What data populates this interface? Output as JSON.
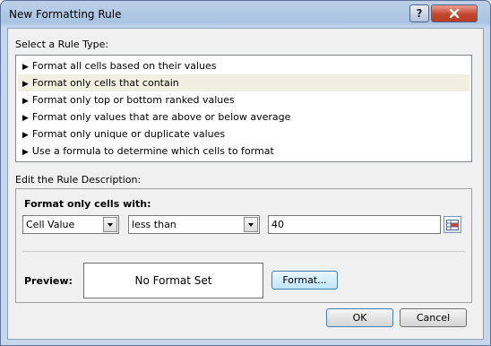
{
  "dialog": {
    "title": "New Formatting Rule",
    "help_label": "?",
    "close_label": "X"
  },
  "rule_type": {
    "label": "Select a Rule Type:",
    "items": [
      {
        "label": "Format all cells based on their values"
      },
      {
        "label": "Format only cells that contain"
      },
      {
        "label": "Format only top or bottom ranked values"
      },
      {
        "label": "Format only values that are above or below average"
      },
      {
        "label": "Format only unique or duplicate values"
      },
      {
        "label": "Use a formula to determine which cells to format"
      }
    ],
    "selected_index": 1
  },
  "description": {
    "label": "Edit the Rule Description:",
    "panel_title": "Format only cells with:",
    "condition_type": "Cell Value",
    "operator": "less than",
    "value": "40"
  },
  "preview": {
    "label": "Preview:",
    "text": "No Format Set",
    "format_button": "Format..."
  },
  "footer": {
    "ok_label": "OK",
    "cancel_label": "Cancel"
  }
}
